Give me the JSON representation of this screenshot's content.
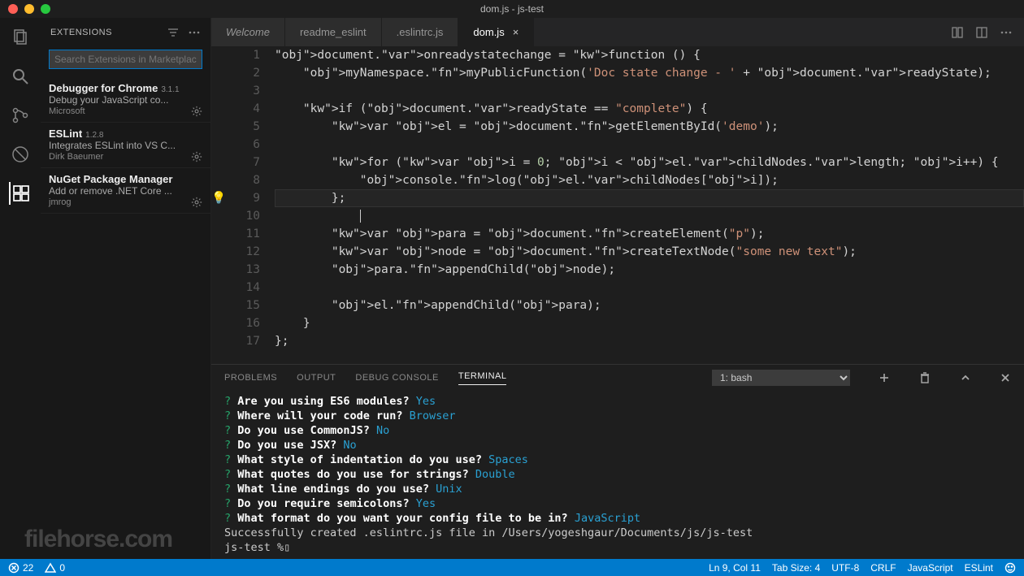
{
  "window": {
    "title": "dom.js - js-test"
  },
  "sidebar": {
    "title": "EXTENSIONS",
    "search_placeholder": "Search Extensions in Marketplace",
    "extensions": [
      {
        "name": "Debugger for Chrome",
        "version": "3.1.1",
        "desc": "Debug your JavaScript co...",
        "author": "Microsoft"
      },
      {
        "name": "ESLint",
        "version": "1.2.8",
        "desc": "Integrates ESLint into VS C...",
        "author": "Dirk Baeumer"
      },
      {
        "name": "NuGet Package Manager",
        "version": "",
        "desc": "Add or remove .NET Core ...",
        "author": "jmrog"
      }
    ]
  },
  "tabs": [
    {
      "label": "Welcome",
      "active": false,
      "italic": true
    },
    {
      "label": "readme_eslint",
      "active": false
    },
    {
      "label": ".eslintrc.js",
      "active": false
    },
    {
      "label": "dom.js",
      "active": true
    }
  ],
  "code": {
    "lines": [
      "document.onreadystatechange = function () {",
      "    myNamespace.myPublicFunction('Doc state change - ' + document.readyState);",
      "",
      "    if (document.readyState == \"complete\") {",
      "        var el = document.getElementById('demo');",
      "",
      "        for (var i = 0; i < el.childNodes.length; i++) {",
      "            console.log(el.childNodes[i]);",
      "        };",
      "",
      "        var para = document.createElement(\"p\");",
      "        var node = document.createTextNode(\"some new text\");",
      "        para.appendChild(node);",
      "",
      "        el.appendChild(para);",
      "    }",
      "};"
    ],
    "current_line": 9,
    "lightbulb_line": 9
  },
  "panel": {
    "tabs": [
      "PROBLEMS",
      "OUTPUT",
      "DEBUG CONSOLE",
      "TERMINAL"
    ],
    "active_tab": "TERMINAL",
    "terminal_selector": "1: bash",
    "terminal_lines": [
      {
        "q": "?",
        "prompt": "Are you using ES6 modules?",
        "answer": "Yes"
      },
      {
        "q": "?",
        "prompt": "Where will your code run?",
        "answer": "Browser"
      },
      {
        "q": "?",
        "prompt": "Do you use CommonJS?",
        "answer": "No"
      },
      {
        "q": "?",
        "prompt": "Do you use JSX?",
        "answer": "No"
      },
      {
        "q": "?",
        "prompt": "What style of indentation do you use?",
        "answer": "Spaces"
      },
      {
        "q": "?",
        "prompt": "What quotes do you use for strings?",
        "answer": "Double"
      },
      {
        "q": "?",
        "prompt": "What line endings do you use?",
        "answer": "Unix"
      },
      {
        "q": "?",
        "prompt": "Do you require semicolons?",
        "answer": "Yes"
      },
      {
        "q": "?",
        "prompt": "What format do you want your config file to be in?",
        "answer": "JavaScript"
      }
    ],
    "terminal_tail": [
      "Successfully created .eslintrc.js file in /Users/yogeshgaur/Documents/js/js-test",
      "js-test %▯"
    ]
  },
  "status": {
    "errors": "22",
    "warnings": "0",
    "cursor": "Ln 9, Col 11",
    "tab_size": "Tab Size: 4",
    "encoding": "UTF-8",
    "eol": "CRLF",
    "language": "JavaScript",
    "linter": "ESLint"
  },
  "watermark": "filehorse.com"
}
